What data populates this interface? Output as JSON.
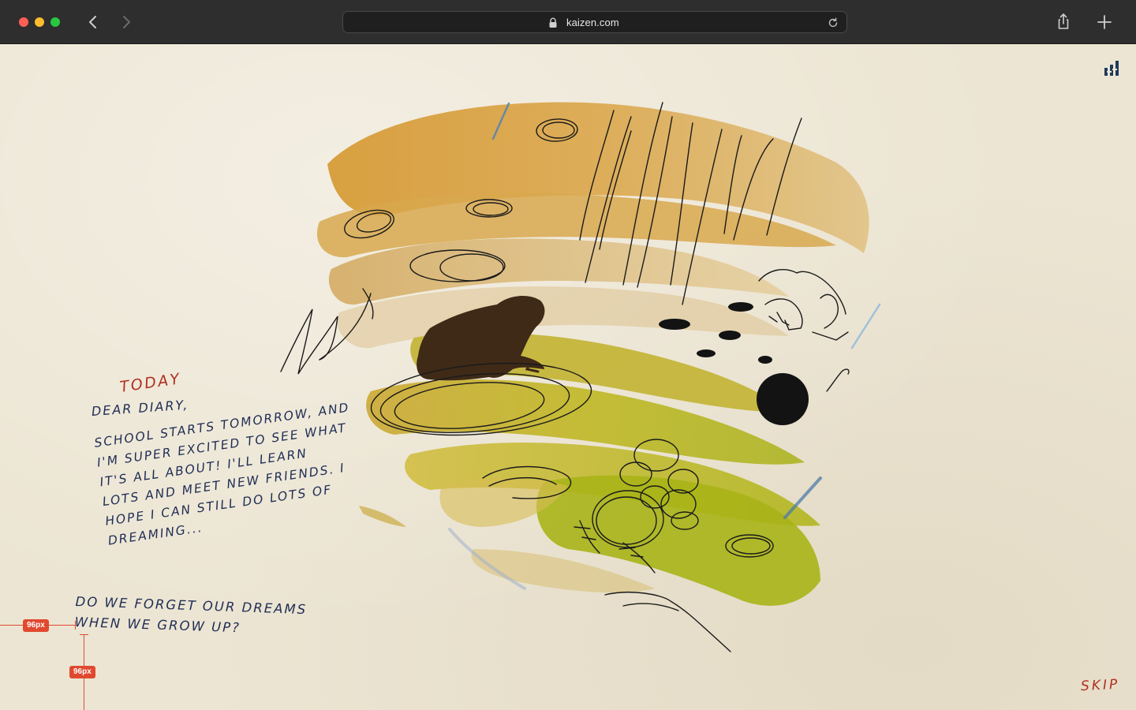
{
  "browser": {
    "url": "kaizen.com",
    "icons": {
      "back": "chevron-left-icon",
      "forward": "chevron-right-icon",
      "lock": "lock-icon",
      "reload": "reload-icon",
      "share": "share-icon",
      "new_tab": "plus-icon"
    }
  },
  "page": {
    "today_label": "TODAY",
    "greeting": "DEAR DIARY,",
    "diary_lines": [
      "SCHOOL STARTS TOMORROW, AND",
      "I'M SUPER EXCITED TO SEE WHAT",
      "IT'S ALL ABOUT! I'LL LEARN",
      "LOTS AND MEET NEW FRIENDS. I",
      "HOPE I CAN STILL DO LOTS OF",
      "DREAMING..."
    ],
    "question_lines": [
      "DO WE FORGET OUR DREAMS",
      "WHEN WE GROW UP?"
    ],
    "skip_label": "SKIP",
    "logo_icon": "bar-chart-logo-icon"
  },
  "guides": {
    "horizontal_label": "96px",
    "vertical_label": "96px"
  },
  "colors": {
    "paper": "#ece5d3",
    "ink_red": "#b1301f",
    "ink_navy": "#1f2d55",
    "ochre": "#d19a3a",
    "olive": "#b5b417",
    "guide": "#e0492f"
  }
}
